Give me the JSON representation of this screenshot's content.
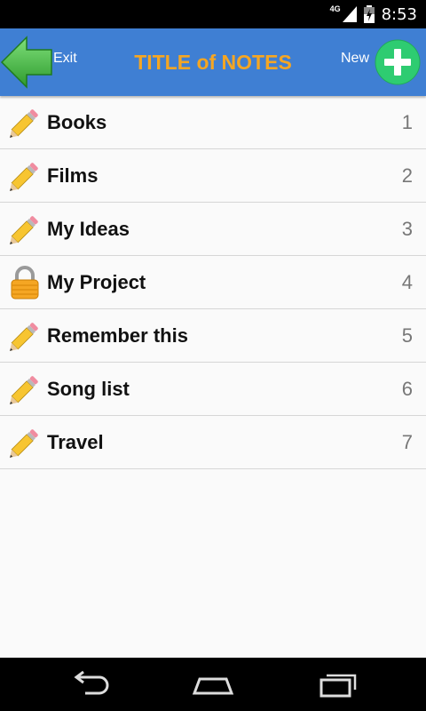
{
  "status_bar": {
    "network": "4G",
    "time": "8:53"
  },
  "app_bar": {
    "exit_label": "Exit",
    "title": "TITLE of NOTES",
    "new_label": "New"
  },
  "notes": [
    {
      "label": "Books",
      "number": "1",
      "icon": "pencil-icon"
    },
    {
      "label": "Films",
      "number": "2",
      "icon": "pencil-icon"
    },
    {
      "label": "My Ideas",
      "number": "3",
      "icon": "pencil-icon"
    },
    {
      "label": "My Project",
      "number": "4",
      "icon": "lock-icon"
    },
    {
      "label": "Remember this",
      "number": "5",
      "icon": "pencil-icon"
    },
    {
      "label": "Song list",
      "number": "6",
      "icon": "pencil-icon"
    },
    {
      "label": "Travel",
      "number": "7",
      "icon": "pencil-icon"
    }
  ],
  "colors": {
    "app_bar": "#3f7fd3",
    "title": "#f5a623",
    "new_button": "#2ecc71",
    "exit_arrow": "#3cb043"
  },
  "nav_bar": {
    "icons": [
      "back-icon",
      "home-icon",
      "recent-apps-icon"
    ]
  }
}
